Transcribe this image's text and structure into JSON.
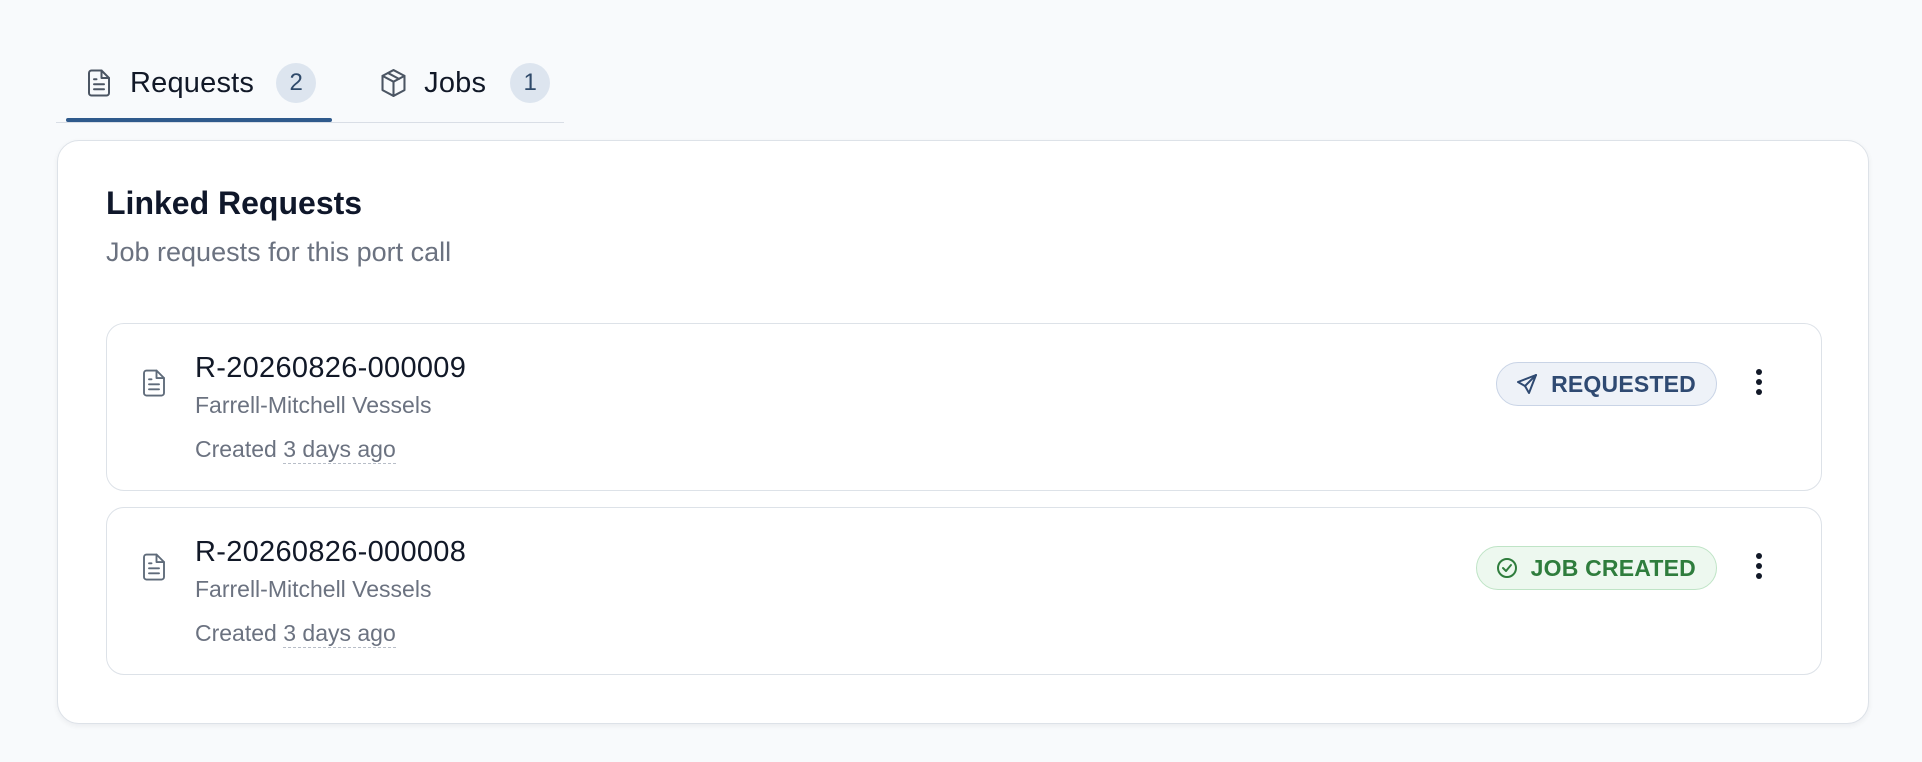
{
  "tabs": [
    {
      "label": "Requests",
      "count": "2",
      "icon": "document-icon",
      "active": true
    },
    {
      "label": "Jobs",
      "count": "1",
      "icon": "cube-icon",
      "active": false
    }
  ],
  "panel": {
    "title": "Linked Requests",
    "subtitle": "Job requests for this port call",
    "requests": [
      {
        "id": "R-20260826-000009",
        "company": "Farrell-Mitchell Vessels",
        "created_prefix": "Created",
        "created_time": "3 days ago",
        "status": "REQUESTED",
        "status_icon": "send-icon",
        "status_color": "#2f4a72"
      },
      {
        "id": "R-20260826-000008",
        "company": "Farrell-Mitchell Vessels",
        "created_prefix": "Created",
        "created_time": "3 days ago",
        "status": "JOB CREATED",
        "status_icon": "check-circle-icon",
        "status_color": "#2f7d3d"
      }
    ]
  },
  "colors": {
    "accent": "#2f5a8c",
    "page_background": "#f8fafc",
    "badge_background": "#dde5ef"
  }
}
